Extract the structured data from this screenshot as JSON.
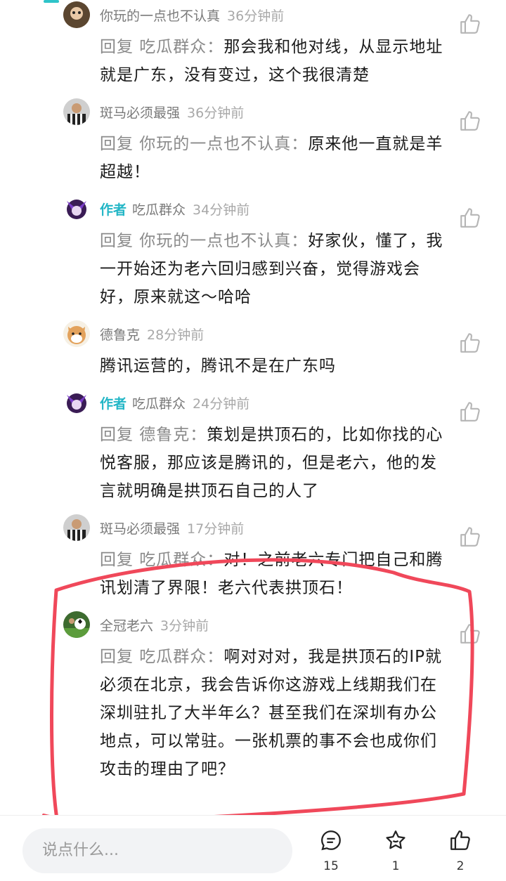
{
  "comments": [
    {
      "name": "你玩的一点也不认真",
      "time": "36分钟前",
      "reply_prefix": "回复 吃瓜群众：",
      "text": "那会我和他对线，从显示地址就是广东，没有变过，这个我很清楚"
    },
    {
      "name": "斑马必须最强",
      "time": "36分钟前",
      "reply_prefix": "回复 你玩的一点也不认真：",
      "text": "原来他一直就是羊超越！"
    },
    {
      "author_tag": "作者",
      "name": "吃瓜群众",
      "time": "34分钟前",
      "reply_prefix": "回复 你玩的一点也不认真：",
      "text": "好家伙，懂了，我一开始还为老六回归感到兴奋，觉得游戏会好，原来就这～哈哈"
    },
    {
      "name": "德鲁克",
      "time": "28分钟前",
      "reply_prefix": "",
      "text": "腾讯运营的，腾讯不是在广东吗"
    },
    {
      "author_tag": "作者",
      "name": "吃瓜群众",
      "time": "24分钟前",
      "reply_prefix": "回复 德鲁克：",
      "text": "策划是拱顶石的，比如你找的心悦客服，那应该是腾讯的，但是老六，他的发言就明确是拱顶石自己的人了"
    },
    {
      "name": "斑马必须最强",
      "time": "17分钟前",
      "reply_prefix": "回复 吃瓜群众：",
      "text": "对！之前老六专门把自己和腾讯划清了界限！老六代表拱顶石！"
    },
    {
      "name": "全冠老六",
      "time": "3分钟前",
      "reply_prefix": "回复 吃瓜群众：",
      "text": "啊对对对，我是拱顶石的IP就必须在北京，我会告诉你这游戏上线期我们在深圳驻扎了大半年么？甚至我们在深圳有办公地点，可以常驻。一张机票的事不会也成你们攻击的理由了吧？"
    }
  ],
  "bottom_bar": {
    "input_placeholder": "说点什么...",
    "comment_count": "15",
    "favorite_count": "1",
    "like_count": "2"
  },
  "colors": {
    "accent": "#23b6c6",
    "highlight_circle": "#f0485a"
  }
}
